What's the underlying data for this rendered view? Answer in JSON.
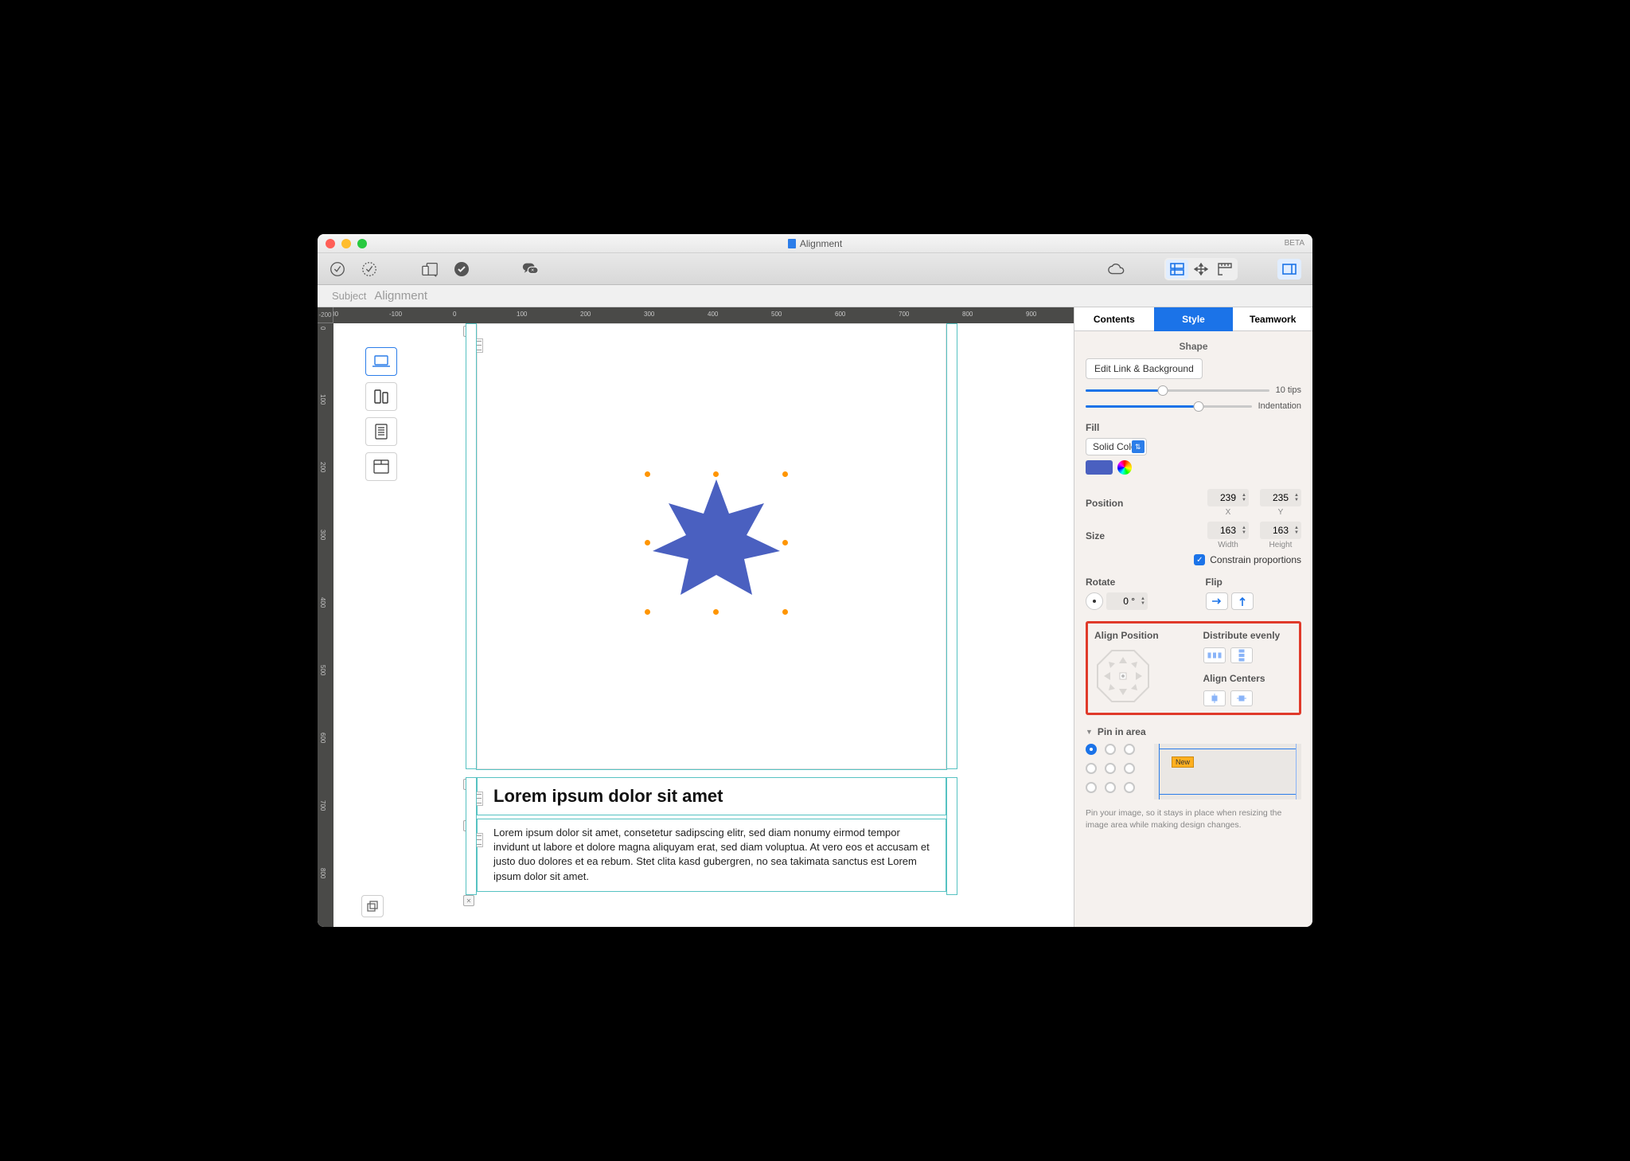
{
  "titlebar": {
    "title": "Alignment",
    "beta": "BETA"
  },
  "subject": {
    "label": "Subject",
    "value": "Alignment"
  },
  "ruler_h": [
    "-200",
    "-100",
    "0",
    "100",
    "200",
    "300",
    "400",
    "500",
    "600",
    "700",
    "800",
    "900"
  ],
  "ruler_v": [
    "0",
    "100",
    "200",
    "300",
    "400",
    "500",
    "600",
    "700",
    "800"
  ],
  "content": {
    "heading": "Lorem ipsum dolor sit amet",
    "body": "Lorem ipsum dolor sit amet, consetetur sadipscing elitr, sed diam nonumy eirmod tempor invidunt ut labore et dolore magna aliquyam erat, sed diam voluptua. At vero eos et accusam et justo duo dolores et ea rebum. Stet clita kasd gubergren, no sea takimata sanctus est Lorem ipsum dolor sit amet."
  },
  "inspector": {
    "tabs": {
      "contents": "Contents",
      "style": "Style",
      "teamwork": "Teamwork"
    },
    "shape": {
      "title": "Shape",
      "edit_btn": "Edit Link & Background",
      "slider1_label": "10 tips",
      "slider2_label": "Indentation"
    },
    "fill": {
      "title": "Fill",
      "mode": "Solid Color"
    },
    "geom": {
      "position_label": "Position",
      "x": "239",
      "y": "235",
      "x_label": "X",
      "y_label": "Y",
      "size_label": "Size",
      "w": "163",
      "h": "163",
      "w_label": "Width",
      "h_label": "Height",
      "constrain": "Constrain proportions"
    },
    "rotate": {
      "label": "Rotate",
      "value": "0 °"
    },
    "flip": {
      "label": "Flip"
    },
    "align": {
      "align_pos": "Align Position",
      "distribute": "Distribute evenly",
      "align_centers": "Align Centers"
    },
    "pin": {
      "title": "Pin in area",
      "badge": "New",
      "help": "Pin your image, so it stays in place when resizing the image area while making design changes."
    }
  }
}
